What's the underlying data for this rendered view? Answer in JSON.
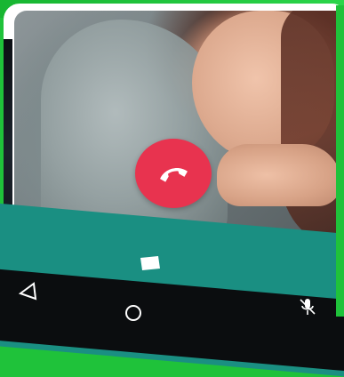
{
  "colors": {
    "accent_green": "#1fc23a",
    "end_call_red": "#e8334f",
    "bottom_bar_teal": "#1a8f82",
    "nav_bar": "#0b0d0f"
  },
  "call_screen": {
    "end_call_icon": "phone-hangup-icon",
    "chat_icon": "message-icon",
    "mute_icon": "mic-off-icon"
  },
  "nav": {
    "back_icon": "back-triangle-icon",
    "home_icon": "home-circle-icon"
  }
}
